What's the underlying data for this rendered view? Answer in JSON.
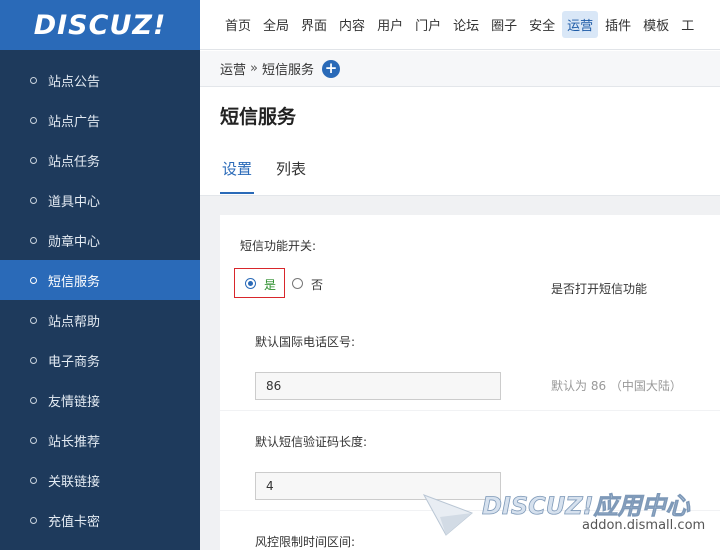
{
  "brand": {
    "logo": "DISCUZ!"
  },
  "sidebar": {
    "items": [
      {
        "label": "站点公告"
      },
      {
        "label": "站点广告"
      },
      {
        "label": "站点任务"
      },
      {
        "label": "道具中心"
      },
      {
        "label": "勋章中心"
      },
      {
        "label": "短信服务"
      },
      {
        "label": "站点帮助"
      },
      {
        "label": "电子商务"
      },
      {
        "label": "友情链接"
      },
      {
        "label": "站长推荐"
      },
      {
        "label": "关联链接"
      },
      {
        "label": "充值卡密"
      }
    ],
    "active_index": 5
  },
  "topnav": {
    "items": [
      {
        "label": "首页"
      },
      {
        "label": "全局"
      },
      {
        "label": "界面"
      },
      {
        "label": "内容"
      },
      {
        "label": "用户"
      },
      {
        "label": "门户"
      },
      {
        "label": "论坛"
      },
      {
        "label": "圈子"
      },
      {
        "label": "安全"
      },
      {
        "label": "运营"
      },
      {
        "label": "插件"
      },
      {
        "label": "模板"
      },
      {
        "label": "工"
      }
    ],
    "active_index": 9
  },
  "breadcrumb": {
    "parent": "运营",
    "separator": "»",
    "current": "短信服务"
  },
  "page": {
    "title": "短信服务",
    "tabs": [
      {
        "label": "设置"
      },
      {
        "label": "列表"
      }
    ]
  },
  "form": {
    "sms_switch": {
      "label": "短信功能开关:",
      "yes": "是",
      "no": "否",
      "value": "是",
      "hint": "是否打开短信功能"
    },
    "intl_code": {
      "label": "默认国际电话区号:",
      "value": "86",
      "hint": "默认为 86 （中国大陆）"
    },
    "code_length": {
      "label": "默认短信验证码长度:",
      "value": "4"
    },
    "risk_time": {
      "label": "风控限制时间区间:"
    }
  },
  "watermark": {
    "text": "DISCUZ!应用中心",
    "url": "addon.dismall.com"
  },
  "colors": {
    "accent": "#2a6ab8",
    "sidebar": "#1e3a5c",
    "highlight_border": "#d8262b",
    "yes_green": "#2a8c2a"
  }
}
